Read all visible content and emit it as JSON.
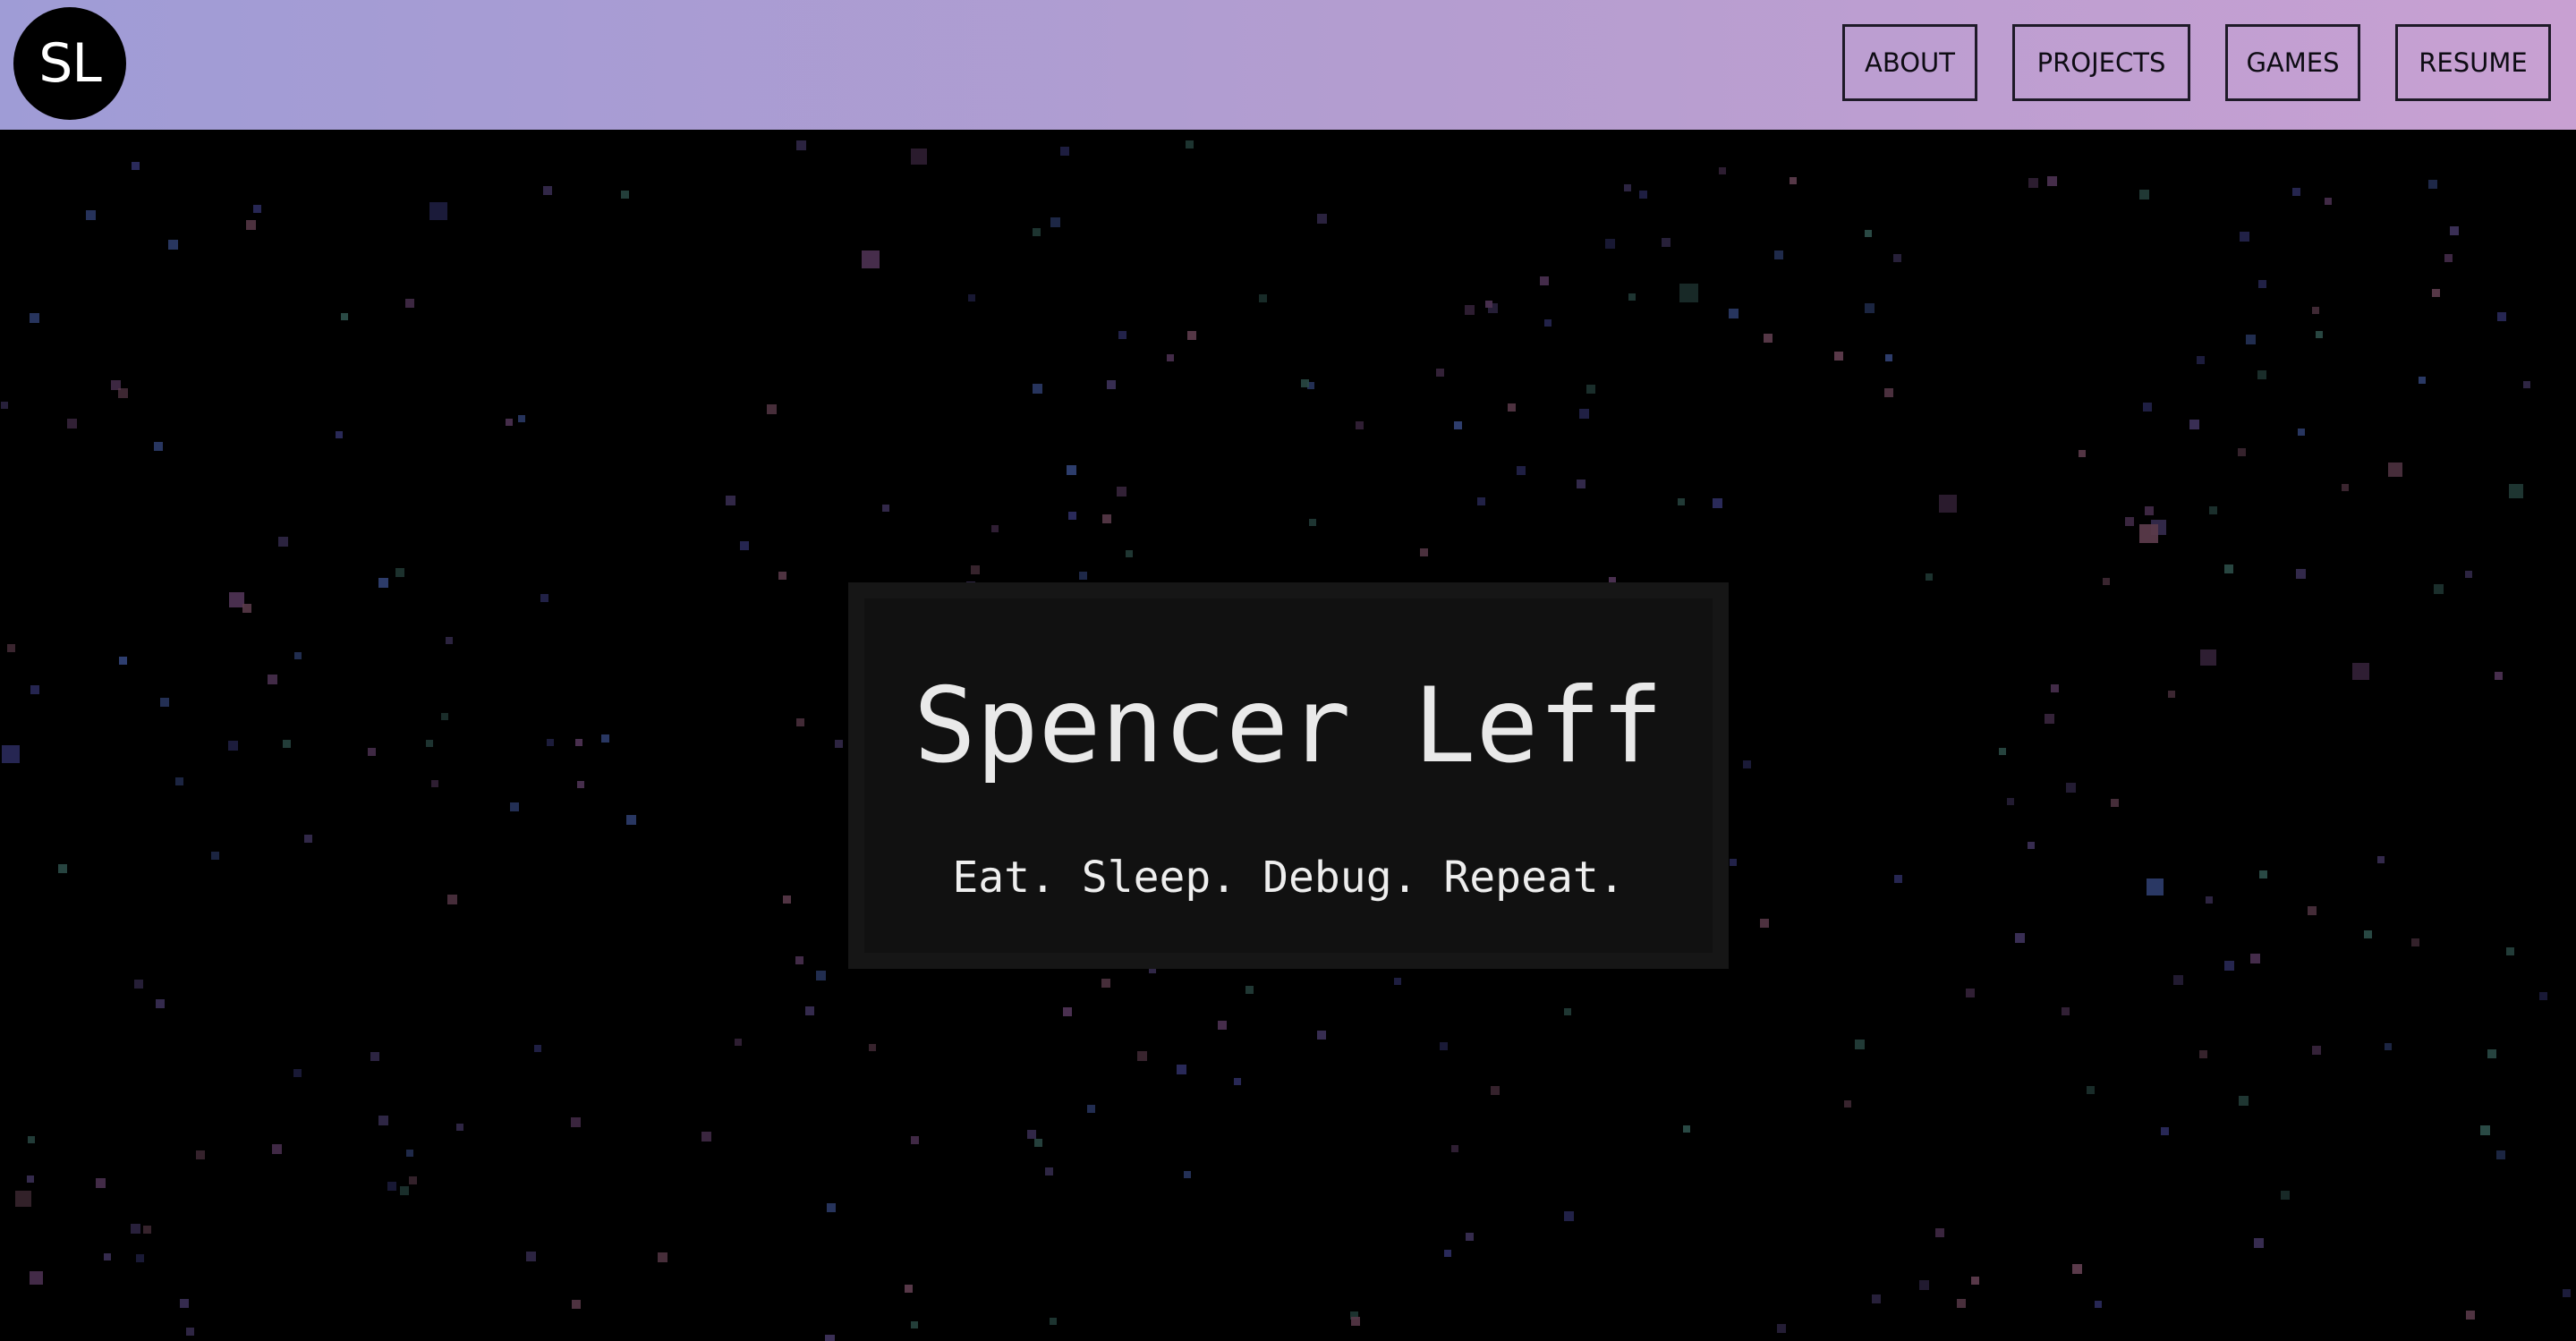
{
  "logo": {
    "text": "SL"
  },
  "nav": {
    "about": "ABOUT",
    "projects": "PROJECTS",
    "games": "GAMES",
    "resume": "RESUME"
  },
  "hero": {
    "title": "Spencer Leff",
    "subtitle": "Eat. Sleep. Debug. Repeat."
  },
  "colors": {
    "nav_gradient_start": "#9f9cd6",
    "nav_gradient_end": "#c8a0d2",
    "background": "#000000",
    "hero_panel": "#111111",
    "star_palette": [
      "#2a2a5a",
      "#3a2f55",
      "#4a3050",
      "#2f3f70",
      "#5a3a4a",
      "#2a4a45"
    ]
  }
}
